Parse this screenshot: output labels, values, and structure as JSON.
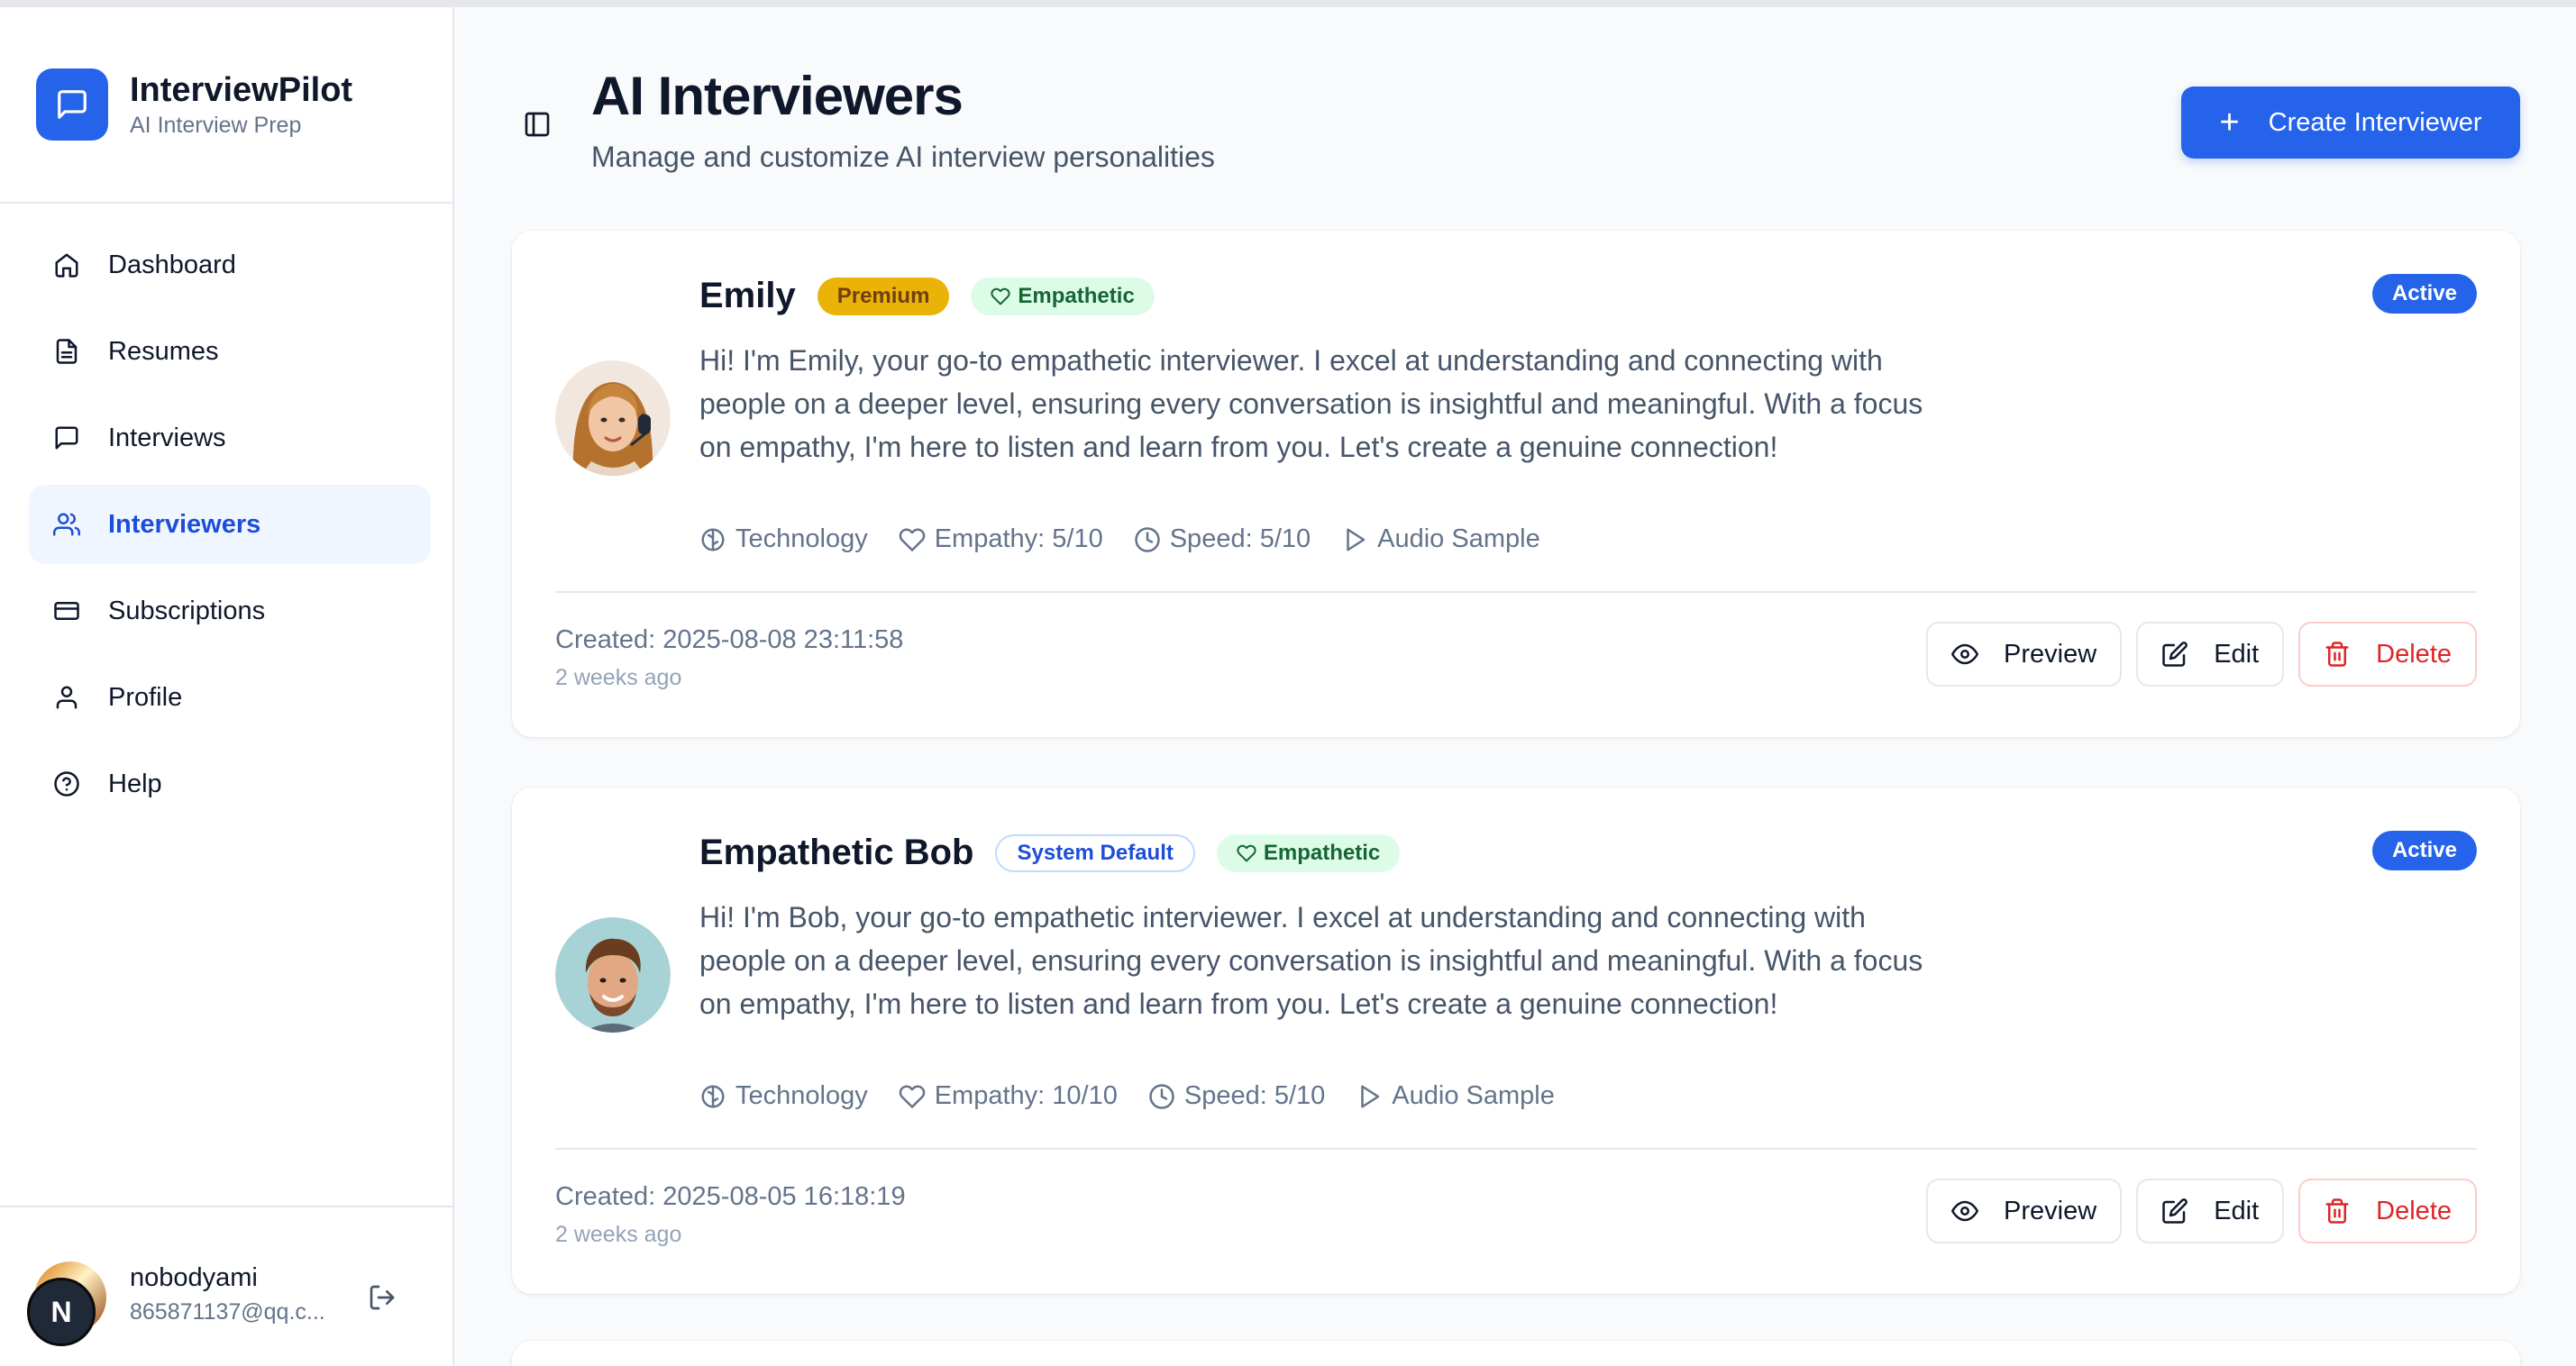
{
  "app": {
    "name": "InterviewPilot",
    "tagline": "AI Interview Prep"
  },
  "sidebar": {
    "items": [
      {
        "label": "Dashboard",
        "icon": "home-icon",
        "active": false
      },
      {
        "label": "Resumes",
        "icon": "file-text-icon",
        "active": false
      },
      {
        "label": "Interviews",
        "icon": "message-square-icon",
        "active": false
      },
      {
        "label": "Interviewers",
        "icon": "users-icon",
        "active": true
      },
      {
        "label": "Subscriptions",
        "icon": "credit-card-icon",
        "active": false
      },
      {
        "label": "Profile",
        "icon": "user-icon",
        "active": false
      },
      {
        "label": "Help",
        "icon": "help-circle-icon",
        "active": false
      }
    ]
  },
  "user": {
    "initial": "N",
    "name": "nobodyami",
    "email": "865871137@qq.c..."
  },
  "header": {
    "title": "AI Interviewers",
    "subtitle": "Manage and customize AI interview personalities",
    "create_label": "Create Interviewer"
  },
  "interviewers": [
    {
      "name": "Emily",
      "tier_badge": "Premium",
      "trait_badge": "Empathetic",
      "status": "Active",
      "description": "Hi! I'm Emily, your go-to empathetic interviewer. I excel at understanding and connecting with people on a deeper level, ensuring every conversation is insightful and meaningful. With a focus on empathy, I'm here to listen and learn from you. Let's create a genuine connection!",
      "field": "Technology",
      "empathy": "Empathy: 5/10",
      "speed": "Speed: 5/10",
      "audio": "Audio Sample",
      "created": "Created: 2025-08-08 23:11:58",
      "ago": "2 weeks ago"
    },
    {
      "name": "Empathetic Bob",
      "tier_badge": "System Default",
      "trait_badge": "Empathetic",
      "status": "Active",
      "description": "Hi! I'm Bob, your go-to empathetic interviewer. I excel at understanding and connecting with people on a deeper level, ensuring every conversation is insightful and meaningful. With a focus on empathy, I'm here to listen and learn from you. Let's create a genuine connection!",
      "field": "Technology",
      "empathy": "Empathy: 10/10",
      "speed": "Speed: 5/10",
      "audio": "Audio Sample",
      "created": "Created: 2025-08-05 16:18:19",
      "ago": "2 weeks ago"
    }
  ],
  "actions": {
    "preview": "Preview",
    "edit": "Edit",
    "delete": "Delete"
  },
  "colors": {
    "accent": "#2563eb",
    "premium": "#eab308",
    "empathetic_bg": "#dcfce7",
    "danger": "#dc2626"
  }
}
